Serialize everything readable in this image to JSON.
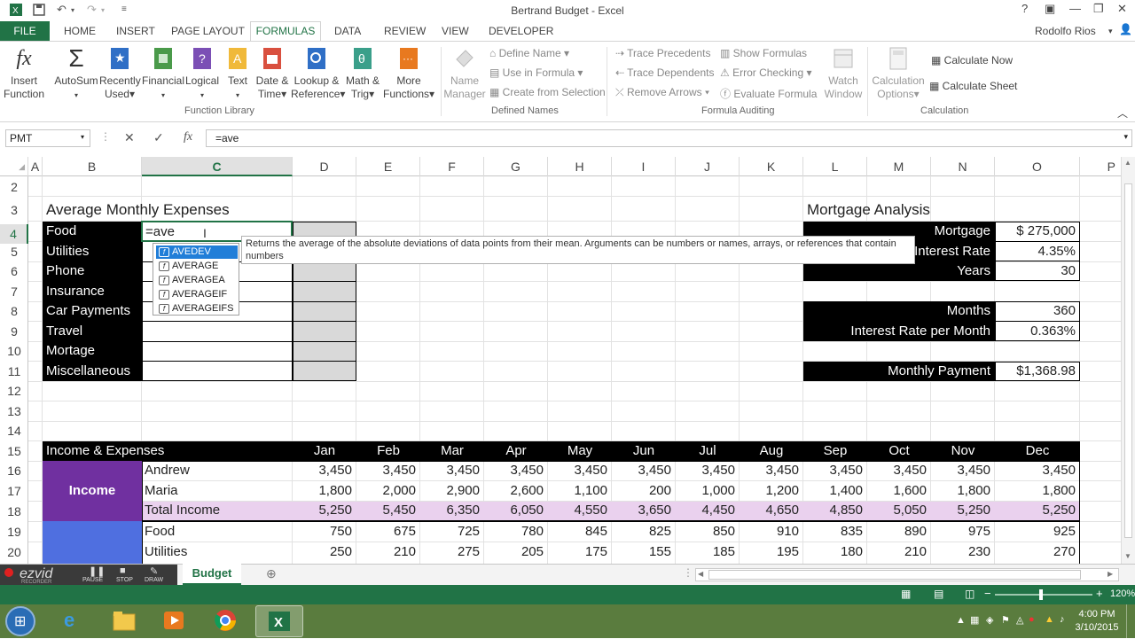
{
  "window": {
    "title": "Bertrand Budget - Excel",
    "user": "Rodolfo Rios"
  },
  "ribbon_tabs": [
    "FILE",
    "HOME",
    "INSERT",
    "PAGE LAYOUT",
    "FORMULAS",
    "DATA",
    "REVIEW",
    "VIEW",
    "DEVELOPER"
  ],
  "ribbon": {
    "insert_function": [
      "Insert",
      "Function"
    ],
    "autosum": [
      "AutoSum"
    ],
    "recently_used": [
      "Recently",
      "Used"
    ],
    "financial": [
      "Financial"
    ],
    "logical": [
      "Logical"
    ],
    "text": [
      "Text"
    ],
    "date_time": [
      "Date &",
      "Time"
    ],
    "lookup": [
      "Lookup &",
      "Reference"
    ],
    "math": [
      "Math &",
      "Trig"
    ],
    "more": [
      "More",
      "Functions"
    ],
    "name_manager": [
      "Name",
      "Manager"
    ],
    "define_name": "Define Name",
    "use_in_formula": "Use in Formula",
    "create_from_selection": "Create from Selection",
    "trace_precedents": "Trace Precedents",
    "trace_dependents": "Trace Dependents",
    "remove_arrows": "Remove Arrows",
    "show_formulas": "Show Formulas",
    "error_checking": "Error Checking",
    "evaluate_formula": "Evaluate Formula",
    "watch_window": [
      "Watch",
      "Window"
    ],
    "calc_options": [
      "Calculation",
      "Options"
    ],
    "calc_now": "Calculate Now",
    "calc_sheet": "Calculate Sheet",
    "groups": [
      "Function Library",
      "Defined Names",
      "Formula Auditing",
      "Calculation"
    ]
  },
  "formula_bar": {
    "name_box": "PMT",
    "formula": "=ave"
  },
  "columns": [
    "A",
    "B",
    "C",
    "D",
    "E",
    "F",
    "G",
    "H",
    "I",
    "J",
    "K",
    "L",
    "M",
    "N",
    "O",
    "P"
  ],
  "rows": [
    "2",
    "3",
    "4",
    "5",
    "6",
    "7",
    "8",
    "9",
    "10",
    "11",
    "12",
    "13",
    "14",
    "15",
    "16",
    "17",
    "18",
    "19",
    "20"
  ],
  "expenses": {
    "title": "Average Monthly Expenses",
    "items": [
      "Food",
      "Utilities",
      "Phone",
      "Insurance",
      "Car Payments",
      "Travel",
      "Mortage",
      "Miscellaneous"
    ],
    "active_cell_text": "=ave"
  },
  "mortgage": {
    "title": "Mortgage Analysis",
    "rows": [
      {
        "label": "Mortgage",
        "value": "$    275,000"
      },
      {
        "label": "Interest Rate",
        "value": "4.35%"
      },
      {
        "label": "Years",
        "value": "30"
      },
      {
        "label": "Months",
        "value": "360"
      },
      {
        "label": "Interest Rate per Month",
        "value": "0.363%"
      },
      {
        "label": "Monthly Payment",
        "value": "$1,368.98"
      }
    ]
  },
  "autocomplete": {
    "items": [
      "AVEDEV",
      "AVERAGE",
      "AVERAGEA",
      "AVERAGEIF",
      "AVERAGEIFS"
    ],
    "selected": 0,
    "tooltip": "Returns the average of the absolute deviations of data points from their mean. Arguments can be numbers or names, arrays, or references that contain numbers"
  },
  "income_table": {
    "header": "Income & Expenses",
    "months": [
      "Jan",
      "Feb",
      "Mar",
      "Apr",
      "May",
      "Jun",
      "Jul",
      "Aug",
      "Sep",
      "Oct",
      "Nov",
      "Dec"
    ],
    "income_label": "Income",
    "rows": [
      {
        "name": "Andrew",
        "values": [
          "3,450",
          "3,450",
          "3,450",
          "3,450",
          "3,450",
          "3,450",
          "3,450",
          "3,450",
          "3,450",
          "3,450",
          "3,450",
          "3,450"
        ]
      },
      {
        "name": "Maria",
        "values": [
          "1,800",
          "2,000",
          "2,900",
          "2,600",
          "1,100",
          "200",
          "1,000",
          "1,200",
          "1,400",
          "1,600",
          "1,800",
          "1,800"
        ]
      },
      {
        "name": "Total Income",
        "values": [
          "5,250",
          "5,450",
          "6,350",
          "6,050",
          "4,550",
          "3,650",
          "4,450",
          "4,650",
          "4,850",
          "5,050",
          "5,250",
          "5,250"
        ]
      },
      {
        "name": "Food",
        "values": [
          "750",
          "675",
          "725",
          "780",
          "845",
          "825",
          "850",
          "910",
          "835",
          "890",
          "975",
          "925"
        ]
      },
      {
        "name": "Utilities",
        "values": [
          "250",
          "210",
          "275",
          "205",
          "175",
          "155",
          "185",
          "195",
          "180",
          "210",
          "230",
          "270"
        ]
      }
    ]
  },
  "sheet_tab": "Budget",
  "recorder": {
    "brand": "ezvid",
    "sub": "RECORDER",
    "buttons": [
      "PAUSE",
      "STOP",
      "DRAW"
    ]
  },
  "status": {
    "zoom": "120%"
  },
  "clock": {
    "time": "4:00 PM",
    "date": "3/10/2015"
  },
  "colors": {
    "excel_green": "#217346",
    "income_purple": "#7030a0",
    "expense_blue": "#4f6fe0",
    "total_pink": "#ead1ee"
  }
}
